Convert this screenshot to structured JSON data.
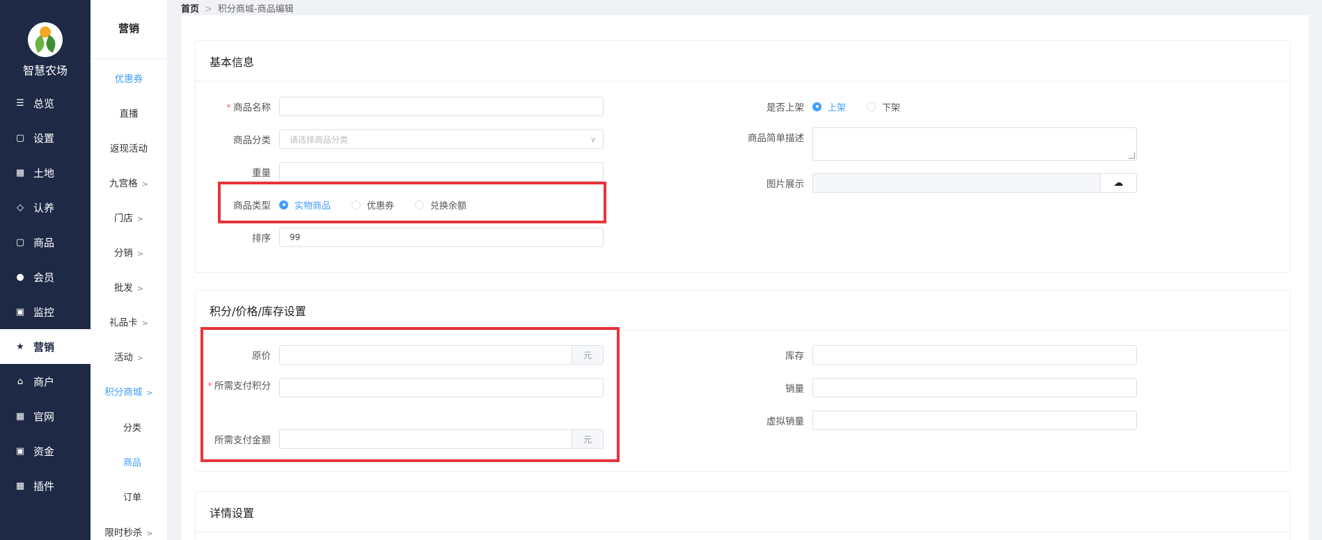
{
  "app": {
    "name": "智慧农场"
  },
  "nav1": [
    {
      "label": "总览",
      "icon": "sliders-icon"
    },
    {
      "label": "设置",
      "icon": "bag-icon"
    },
    {
      "label": "土地",
      "icon": "grid-icon"
    },
    {
      "label": "认养",
      "icon": "diamond-icon"
    },
    {
      "label": "商品",
      "icon": "bag-icon"
    },
    {
      "label": "会员",
      "icon": "user-icon"
    },
    {
      "label": "监控",
      "icon": "camera-icon"
    },
    {
      "label": "营销",
      "icon": "star-icon",
      "active": true
    },
    {
      "label": "商户",
      "icon": "store-icon"
    },
    {
      "label": "官网",
      "icon": "grid-icon"
    },
    {
      "label": "资金",
      "icon": "money-icon"
    },
    {
      "label": "插件",
      "icon": "grid-icon"
    }
  ],
  "nav2": {
    "title": "营销",
    "items": [
      {
        "label": "优惠券"
      },
      {
        "label": "直播"
      },
      {
        "label": "返现活动"
      },
      {
        "label": "九宫格"
      },
      {
        "label": "门店"
      },
      {
        "label": "分销"
      },
      {
        "label": "批发"
      },
      {
        "label": "礼品卡"
      },
      {
        "label": "活动"
      },
      {
        "label": "积分商城"
      }
    ],
    "sub": [
      {
        "label": "分类"
      },
      {
        "label": "商品"
      },
      {
        "label": "订单"
      }
    ],
    "last": {
      "label": "限时秒杀"
    }
  },
  "breadcrumb": {
    "home": "首页",
    "current": "积分商城-商品编辑"
  },
  "basic": {
    "title": "基本信息",
    "name_label": "商品名称",
    "category_label": "商品分类",
    "category_placeholder": "请选择商品分类",
    "weight_label": "重量",
    "type_label": "商品类型",
    "type_options": [
      "实物商品",
      "优惠券",
      "兑换余额"
    ],
    "sort_label": "排序",
    "sort_value": "99",
    "shelf_label": "是否上架",
    "shelf_options": [
      "上架",
      "下架"
    ],
    "desc_label": "商品简单描述",
    "image_label": "图片展示"
  },
  "pricing": {
    "title": "积分/价格/库存设置",
    "orig_price_label": "原价",
    "unit": "元",
    "points_label": "所需支付积分",
    "amount_label": "所需支付金额",
    "stock_label": "库存",
    "sales_label": "销量",
    "virtual_sales_label": "虚拟销量"
  },
  "detail": {
    "title": "详情设置"
  },
  "colors": {
    "accent": "#409eff",
    "nav_bg": "#1e2a45",
    "highlight": "#e8333b",
    "required": "#f56c6c"
  }
}
